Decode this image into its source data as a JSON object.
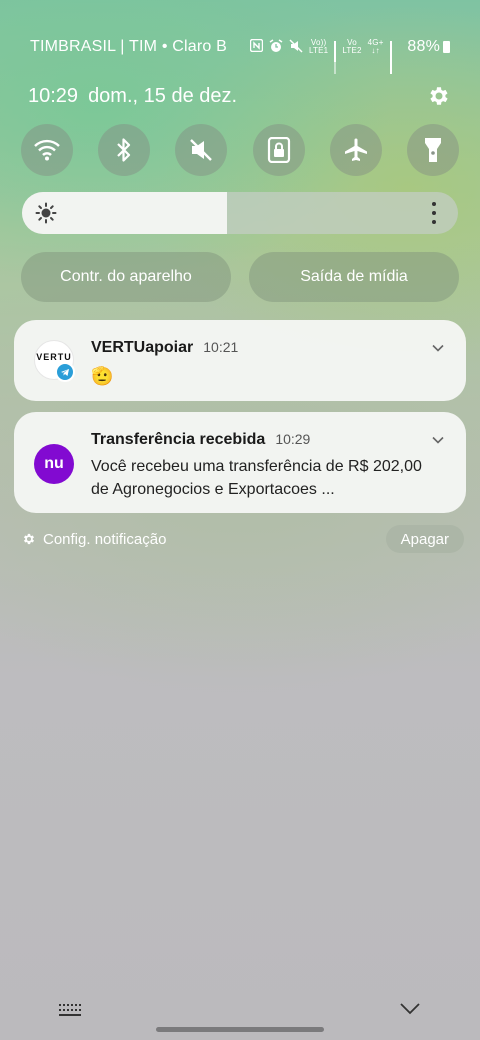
{
  "status_bar": {
    "carrier": "TIMBRASIL | TIM • Claro B",
    "icons": [
      "nfc-icon",
      "alarm-icon",
      "mute-icon",
      "volte-icon",
      "signal-icon",
      "lte2-icon",
      "signal-icon"
    ],
    "volte_label": "Vo))",
    "lte1_label": "LTE1",
    "lte2_label": "LTE2",
    "net_4g": "4G+",
    "battery_percent": "88%"
  },
  "header": {
    "time": "10:29",
    "date": "dom., 15 de dez."
  },
  "quick_toggles": [
    {
      "name": "wifi",
      "icon": "wifi-icon"
    },
    {
      "name": "bluetooth",
      "icon": "bluetooth-icon"
    },
    {
      "name": "sound",
      "icon": "mute-icon"
    },
    {
      "name": "rotation-lock",
      "icon": "rotation-lock-icon"
    },
    {
      "name": "airplane",
      "icon": "airplane-icon"
    },
    {
      "name": "flashlight",
      "icon": "flashlight-icon"
    }
  ],
  "brightness": {
    "level": 0.47
  },
  "pills": {
    "device_control": "Contr. do aparelho",
    "media_output": "Saída de mídia"
  },
  "notifications": [
    {
      "app": "VERTU",
      "title": "VERTUapoiar",
      "time": "10:21",
      "body": "🫡"
    },
    {
      "app": "nu",
      "title": "Transferência recebida",
      "time": "10:29",
      "body": "Você recebeu uma transferência de R$ 202,00 de Agronegocios e Exportacoes ..."
    }
  ],
  "footer": {
    "settings_label": "Config. notificação",
    "clear_label": "Apagar"
  },
  "colors": {
    "nubank_purple": "#820ad1",
    "telegram_blue": "#2a9ed8"
  }
}
